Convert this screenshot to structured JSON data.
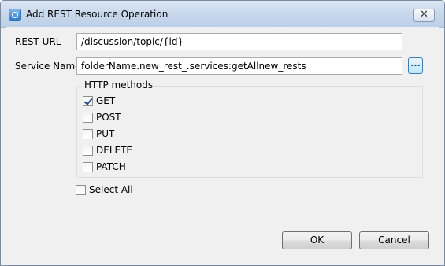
{
  "window": {
    "title": "Add REST Resource Operation",
    "close_glyph": "✕"
  },
  "form": {
    "rest_url_label": "REST URL",
    "rest_url_value": "/discussion/topic/{id}",
    "service_name_label": "Service Name",
    "service_name_value": "folderName.new_rest_.services:getAllnew_rests",
    "browse_label": "..."
  },
  "http_methods": {
    "legend": "HTTP methods",
    "items": [
      {
        "label": "GET",
        "checked": true
      },
      {
        "label": "POST",
        "checked": false
      },
      {
        "label": "PUT",
        "checked": false
      },
      {
        "label": "DELETE",
        "checked": false
      },
      {
        "label": "PATCH",
        "checked": false
      }
    ]
  },
  "select_all": {
    "label": "Select All",
    "checked": false
  },
  "buttons": {
    "ok": "OK",
    "cancel": "Cancel"
  },
  "colors": {
    "titlebar": "#c8d8ec",
    "dialog_bg": "#f0f0f0",
    "accent": "#3c7fb1"
  }
}
